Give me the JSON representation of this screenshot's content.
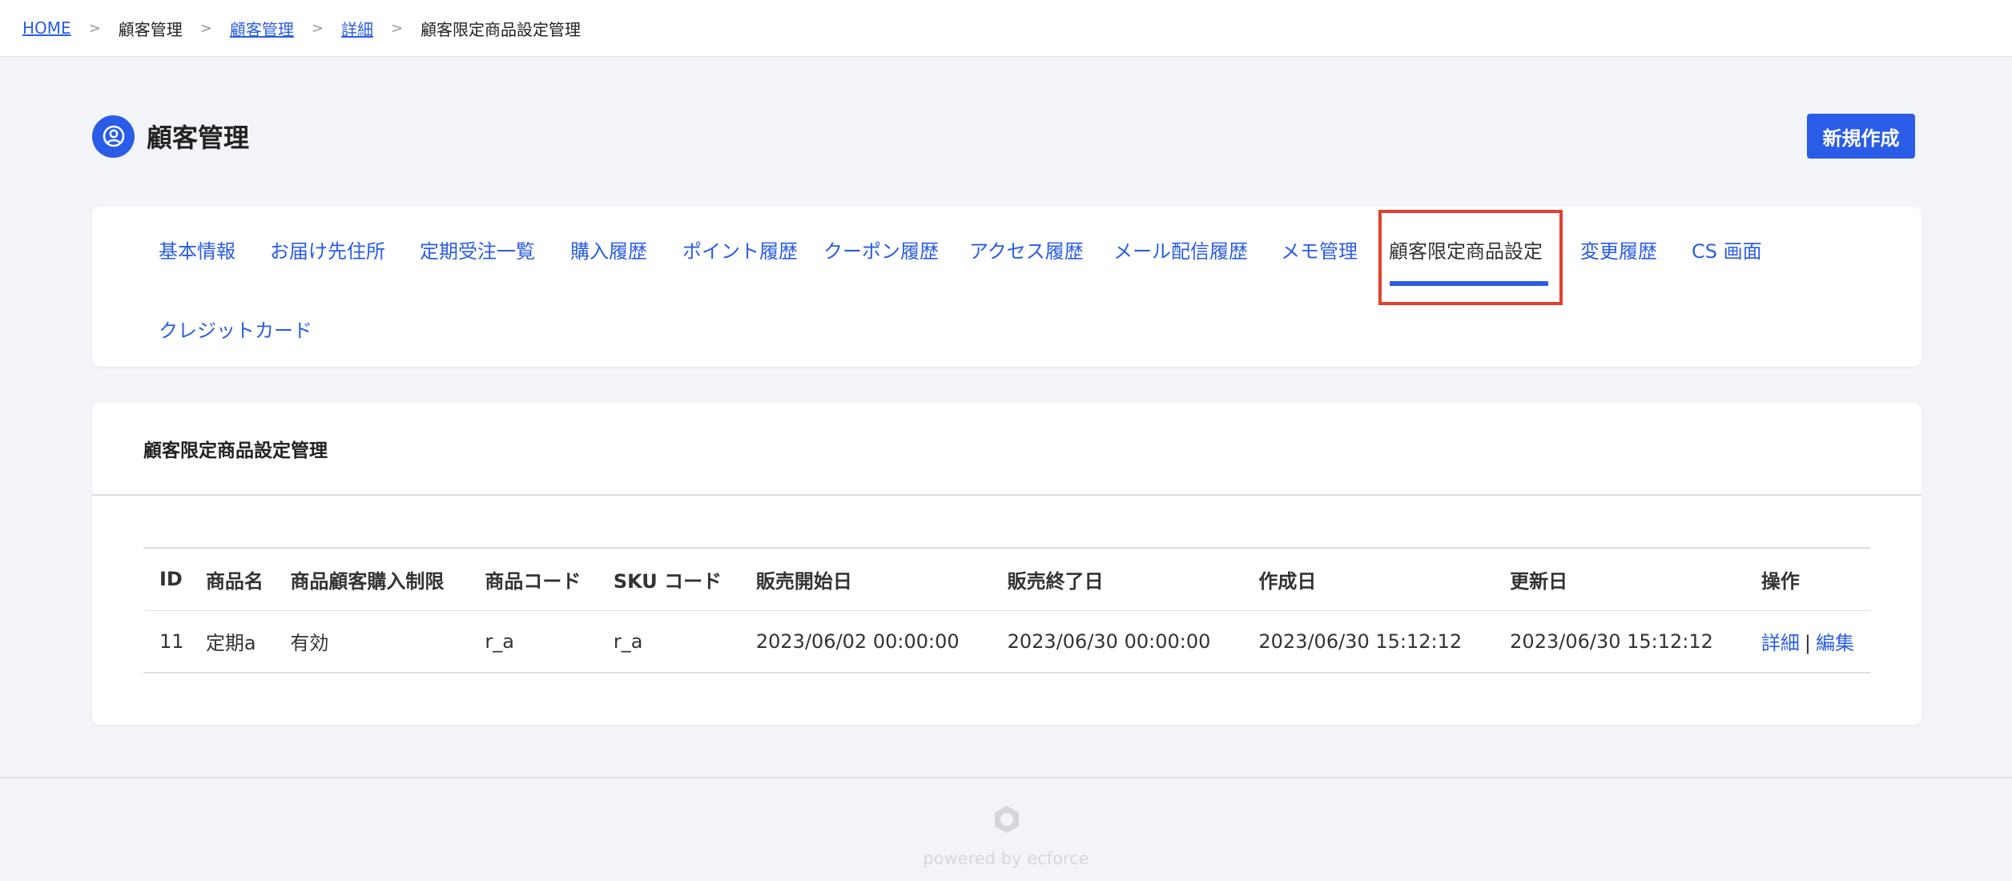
{
  "breadcrumb": {
    "items": [
      {
        "label": "HOME",
        "link": true
      },
      {
        "label": "顧客管理",
        "link": false
      },
      {
        "label": "顧客管理",
        "link": true
      },
      {
        "label": "詳細",
        "link": true
      },
      {
        "label": "顧客限定商品設定管理",
        "link": false
      }
    ],
    "separator": ">"
  },
  "header": {
    "title": "顧客管理",
    "icon": "user-circle-icon",
    "new_button": "新規作成"
  },
  "tabs": [
    {
      "label": "基本情報"
    },
    {
      "label": "お届け先住所"
    },
    {
      "label": "定期受注一覧"
    },
    {
      "label": "購入履歴"
    },
    {
      "label": "ポイント履歴"
    },
    {
      "label": "クーポン履歴"
    },
    {
      "label": "アクセス履歴"
    },
    {
      "label": "メール配信履歴"
    },
    {
      "label": "メモ管理"
    },
    {
      "label": "顧客限定商品設定",
      "active": true
    },
    {
      "label": "変更履歴"
    },
    {
      "label": "CS 画面"
    },
    {
      "label": "クレジットカード"
    }
  ],
  "content": {
    "title": "顧客限定商品設定管理",
    "table": {
      "headers": [
        "ID",
        "商品名",
        "商品顧客購入制限",
        "商品コード",
        "SKU コード",
        "販売開始日",
        "販売終了日",
        "作成日",
        "更新日",
        "操作"
      ],
      "rows": [
        {
          "id": "11",
          "name": "定期a",
          "limit": "有効",
          "product_code": "r_a",
          "sku_code": "r_a",
          "start": "2023/06/02 00:00:00",
          "end": "2023/06/30 00:00:00",
          "created": "2023/06/30 15:12:12",
          "updated": "2023/06/30 15:12:12",
          "ops": {
            "detail": "詳細",
            "separator": "|",
            "edit": "編集"
          }
        }
      ]
    }
  },
  "footer": {
    "text": "powered by ecforce",
    "logo": "ecforce-logo-icon"
  },
  "colors": {
    "accent": "#2a5ce7",
    "highlight": "#e3412e",
    "background": "#f3f4f7"
  }
}
